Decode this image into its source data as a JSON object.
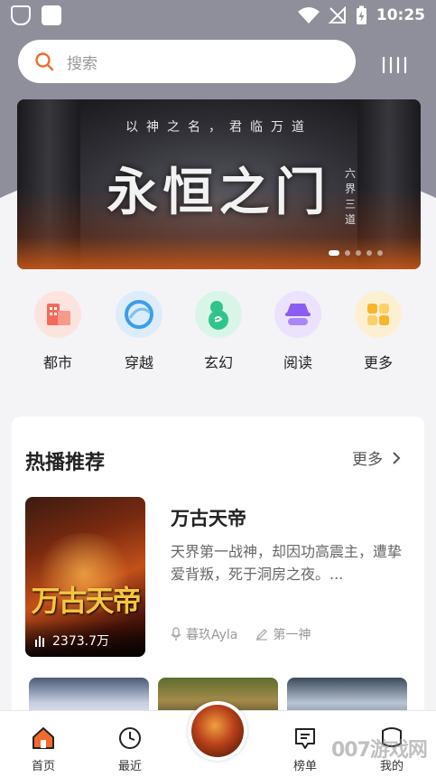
{
  "status_bar": {
    "time": "10:25"
  },
  "search": {
    "placeholder": "搜索"
  },
  "banner": {
    "subtitle": "以神之名，君临万道",
    "title": "永恒之门",
    "side_text": "六界三道",
    "slide_count": 5,
    "active_slide": 1
  },
  "categories": [
    {
      "label": "都市",
      "icon": "city-icon",
      "color": "#f36a5a"
    },
    {
      "label": "穿越",
      "icon": "swirl-icon",
      "color": "#3d9ee8"
    },
    {
      "label": "玄幻",
      "icon": "gourd-icon",
      "color": "#2fc48a"
    },
    {
      "label": "阅读",
      "icon": "incognito-icon",
      "color": "#8b5cf0"
    },
    {
      "label": "更多",
      "icon": "grid-icon",
      "color": "#f7b52a"
    }
  ],
  "section": {
    "title": "热播推荐",
    "more_label": "更多"
  },
  "featured_book": {
    "title": "万古天帝",
    "description": "天界第一战神，却因功高震主，遭挚爱背叛，死于洞房之夜。...",
    "author": "暮玖Ayla",
    "narrator": "第一神",
    "play_count": "2373.7万",
    "cover_title": "万古天帝"
  },
  "bottom_nav": [
    {
      "label": "首页",
      "icon": "home-icon",
      "active": true
    },
    {
      "label": "最近",
      "icon": "clock-icon",
      "active": false
    },
    {
      "label": "",
      "icon": "now-playing-cover",
      "active": false
    },
    {
      "label": "榜单",
      "icon": "ranking-icon",
      "active": false
    },
    {
      "label": "我的",
      "icon": "profile-icon",
      "active": false
    }
  ],
  "watermark": "007游戏网",
  "colors": {
    "accent": "#f26b2c",
    "header_bg": "#8f8f9c"
  }
}
